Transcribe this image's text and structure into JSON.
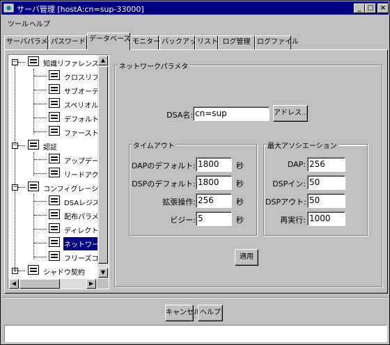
{
  "window": {
    "title": "サーバ管理 [hostA:cn=sup-33000]",
    "minimize": "_",
    "maximize": "□",
    "close": "×"
  },
  "menu": [
    "ツール",
    "ヘルプ"
  ],
  "tabs": [
    "サーバパラメタ",
    "パスワード",
    "データベース",
    "モニター",
    "バックアップ",
    "リストア",
    "ログ管理",
    "ログファイル"
  ],
  "active_tab": "データベース",
  "tree": {
    "groups": [
      {
        "label": "知識リファレンス",
        "expander": "−",
        "children": [
          "クロスリファレンス",
          "サブオーディネート",
          "スペリオルリファレンス",
          "デフォルトリファレンス",
          "ファーストレベル"
        ]
      },
      {
        "label": "認証",
        "expander": "−",
        "children": [
          "アップデート",
          "リードアクセス"
        ]
      },
      {
        "label": "コンフィグレーション",
        "expander": "−",
        "children": [
          "DSAレジストリ",
          "配布パラメタ",
          "ディレクトリコンフィグ",
          "ネットワークパラメタ",
          "フリーズコンフィグ"
        ]
      },
      {
        "label": "シャドウ契約",
        "expander": "+",
        "children": []
      }
    ],
    "selected": "ネットワークパラメタ",
    "scroll_up": "▲",
    "scroll_down": "▼",
    "scroll_left": "◀",
    "scroll_right": "▶"
  },
  "panel": {
    "title": "ネットワークパラメタ",
    "dsa_label": "DSA名:",
    "dsa_value": "cn=sup",
    "address_button": "アドレス...",
    "timeout": {
      "title": "タイムアウト",
      "rows": [
        {
          "label": "DAPのデフォルト:",
          "value": "1800",
          "unit": "秒"
        },
        {
          "label": "DSPのデフォルト:",
          "value": "1800",
          "unit": "秒"
        },
        {
          "label": "拡張操作:",
          "value": "256",
          "unit": "秒"
        },
        {
          "label": "ビジー:",
          "value": "5",
          "unit": "秒"
        }
      ]
    },
    "assoc": {
      "title": "最大アソシエーション",
      "rows": [
        {
          "label": "DAP:",
          "value": "256"
        },
        {
          "label": "DSPイン:",
          "value": "50"
        },
        {
          "label": "DSPアウト:",
          "value": "50"
        },
        {
          "label": "再実行:",
          "value": "1000"
        }
      ]
    },
    "apply_button": "適用"
  },
  "footer": {
    "cancel_button": "キャンセル",
    "help_button": "ヘルプ"
  },
  "status": ""
}
